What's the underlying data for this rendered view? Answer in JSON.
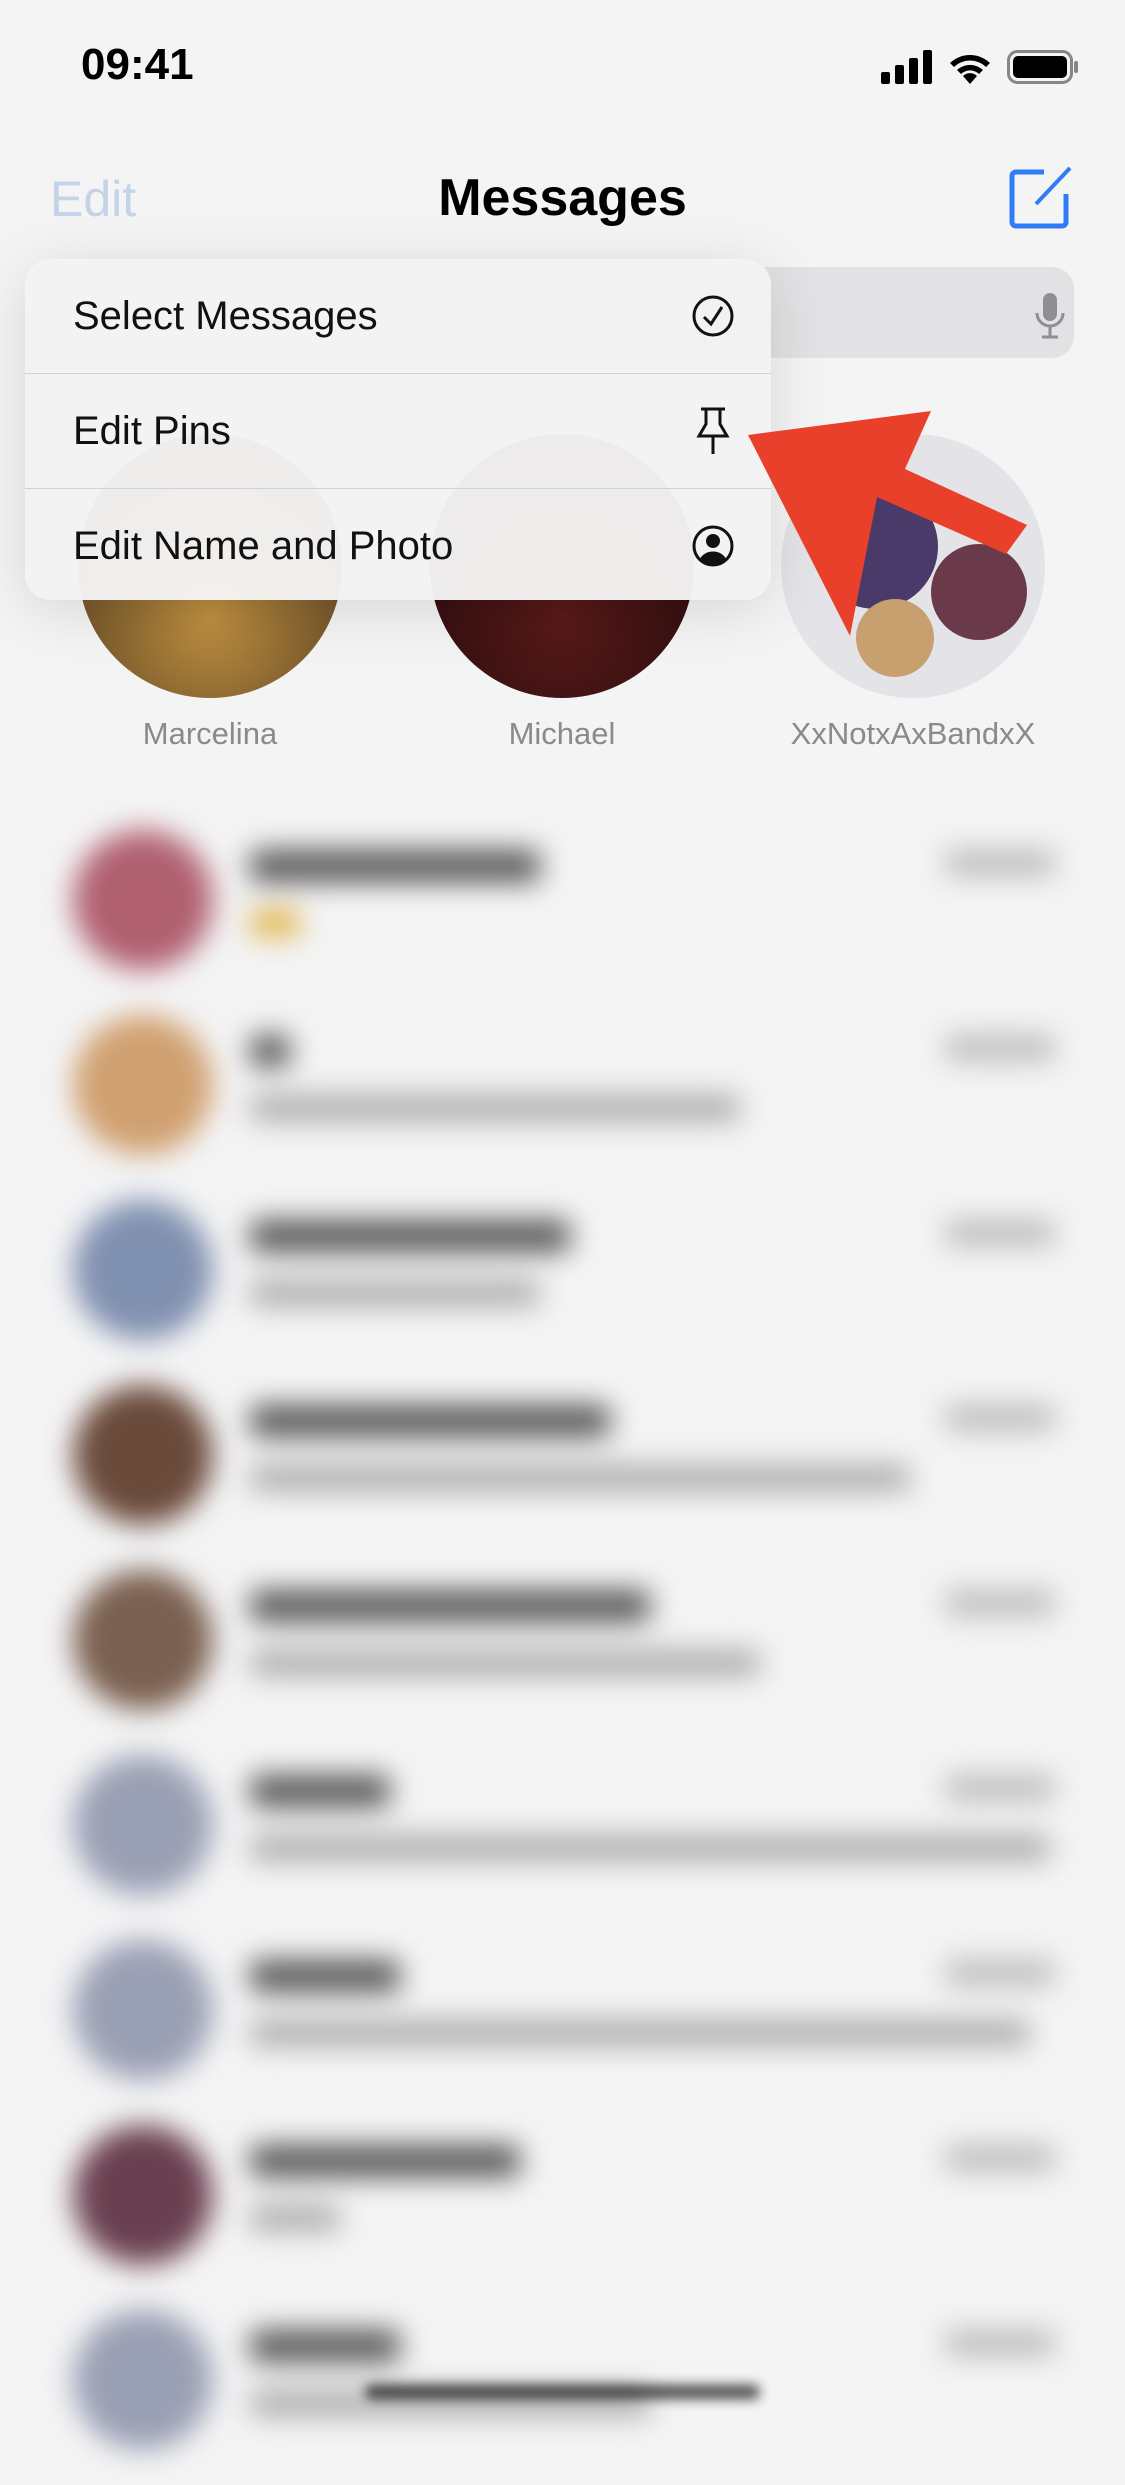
{
  "status_bar": {
    "time": "09:41",
    "icons": [
      "signal-icon",
      "wifi-icon",
      "battery-icon"
    ]
  },
  "nav": {
    "edit_label": "Edit",
    "title": "Messages",
    "compose_icon": "compose-icon"
  },
  "accent_color": "#2f7cf6",
  "context_menu": {
    "items": [
      {
        "label": "Select Messages",
        "icon": "checkmark-circle-icon"
      },
      {
        "label": "Edit Pins",
        "icon": "pin-icon"
      },
      {
        "label": "Edit Name and Photo",
        "icon": "person-circle-icon"
      }
    ]
  },
  "pinned": [
    {
      "name": "Marcelina",
      "color": "#a07a40"
    },
    {
      "name": "Michael",
      "color": "#3a1010"
    },
    {
      "name": "XxNotxAxBandxX",
      "color": "#e6e6ea"
    }
  ],
  "annotation_arrow_color": "#e8402a",
  "conversations": [
    {
      "avatar_color": "#b06070"
    },
    {
      "avatar_color": "#d0a070"
    },
    {
      "avatar_color": "#8090b0"
    },
    {
      "avatar_color": "#6a4a3a"
    },
    {
      "avatar_color": "#7a6050"
    },
    {
      "avatar_color": "#9aa0b4"
    },
    {
      "avatar_color": "#9aa0b4"
    },
    {
      "avatar_color": "#6a4050"
    },
    {
      "avatar_color": "#9aa0b4"
    }
  ]
}
